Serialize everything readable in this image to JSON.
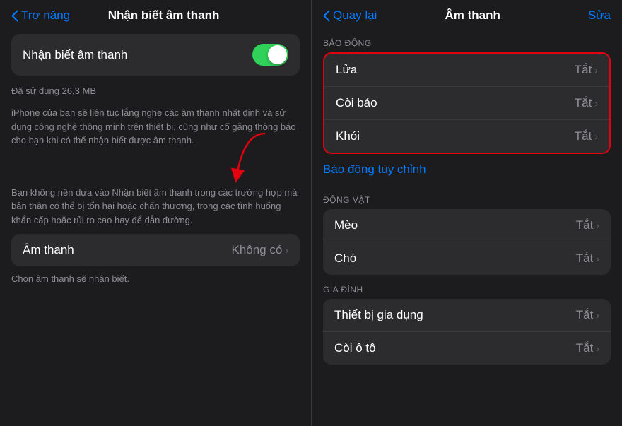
{
  "left": {
    "nav": {
      "back_label": "Trợ năng",
      "title": "Nhận biết âm thanh",
      "action": null
    },
    "toggle": {
      "label": "Nhận biết âm thanh",
      "enabled": true
    },
    "usage": "Đã sử dụng 26,3 MB",
    "description1": "iPhone của bạn sẽ liên tục lắng nghe các âm thanh nhất định và sử dụng công nghệ thông minh trên thiết bị, cũng như cố gắng thông báo cho bạn khi có thể nhận biết được âm thanh.",
    "description2": "Bạn không nên dựa vào Nhận biết âm thanh trong các trường hợp mà bản thân có thể bị tổn hại hoặc chấn thương, trong các tình huống khẩn cấp hoặc rủi ro cao hay để dẫn đường.",
    "sound_row": {
      "label": "Âm thanh",
      "value": "Không có",
      "chevron": "›"
    },
    "sound_hint": "Chọn âm thanh sẽ nhận biết."
  },
  "right": {
    "nav": {
      "back_label": "Quay lại",
      "title": "Âm thanh",
      "action": "Sửa"
    },
    "bao_dong": {
      "section_label": "BÁO ĐỘNG",
      "rows": [
        {
          "label": "Lửa",
          "value": "Tắt"
        },
        {
          "label": "Còi báo",
          "value": "Tắt"
        },
        {
          "label": "Khói",
          "value": "Tắt"
        }
      ],
      "custom_link": "Báo động tùy chỉnh"
    },
    "dong_vat": {
      "section_label": "ĐỘNG VẬT",
      "rows": [
        {
          "label": "Mèo",
          "value": "Tắt"
        },
        {
          "label": "Chó",
          "value": "Tắt"
        }
      ]
    },
    "gia_dinh": {
      "section_label": "GIA ĐÌNH",
      "rows": [
        {
          "label": "Thiết bị gia dụng",
          "value": "Tắt"
        },
        {
          "label": "Còi ô tô",
          "value": "Tắt"
        }
      ]
    },
    "cho_tat": "Cho Tắt"
  }
}
